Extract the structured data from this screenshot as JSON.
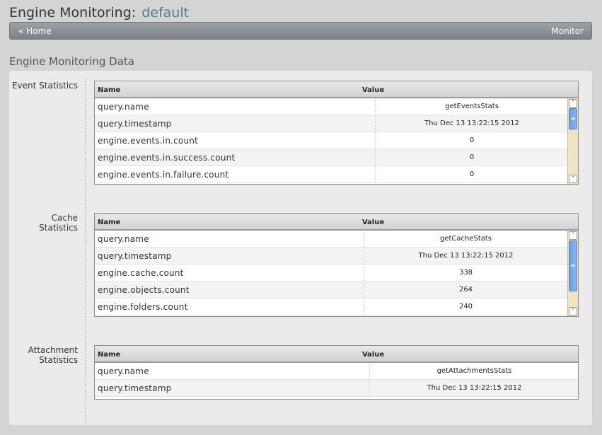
{
  "header": {
    "title": "Engine Monitoring:",
    "subtitle": "default"
  },
  "nav": {
    "home_label": "« Home",
    "monitor_label": "Monitor"
  },
  "section_title": "Engine Monitoring Data",
  "grids": {
    "events": {
      "label_line1": "Event Statistics",
      "label_line2": "",
      "col_name": "Name",
      "col_value": "Value",
      "rows": [
        {
          "name": "query.name",
          "value": "getEventsStats"
        },
        {
          "name": "query.timestamp",
          "value": "Thu Dec 13 13:22:15 2012"
        },
        {
          "name": "engine.events.in.count",
          "value": "0"
        },
        {
          "name": "engine.events.in.success.count",
          "value": "0"
        },
        {
          "name": "engine.events.in.failure.count",
          "value": "0"
        }
      ]
    },
    "cache": {
      "label_line1": "Cache",
      "label_line2": "Statistics",
      "col_name": "Name",
      "col_value": "Value",
      "rows": [
        {
          "name": "query.name",
          "value": "getCacheStats"
        },
        {
          "name": "query.timestamp",
          "value": "Thu Dec 13 13:22:15 2012"
        },
        {
          "name": "engine.cache.count",
          "value": "338"
        },
        {
          "name": "engine.objects.count",
          "value": "264"
        },
        {
          "name": "engine.folders.count",
          "value": "240"
        }
      ]
    },
    "attachments": {
      "label_line1": "Attachment",
      "label_line2": "Statistics",
      "col_name": "Name",
      "col_value": "Value",
      "rows": [
        {
          "name": "query.name",
          "value": "getAttachmentsStats"
        },
        {
          "name": "query.timestamp",
          "value": "Thu Dec 13 13:22:15 2012"
        }
      ]
    }
  },
  "scrollbar_icons": {
    "up": "chevron-up-icon",
    "down": "chevron-down-icon",
    "grip": "grip-icon"
  }
}
